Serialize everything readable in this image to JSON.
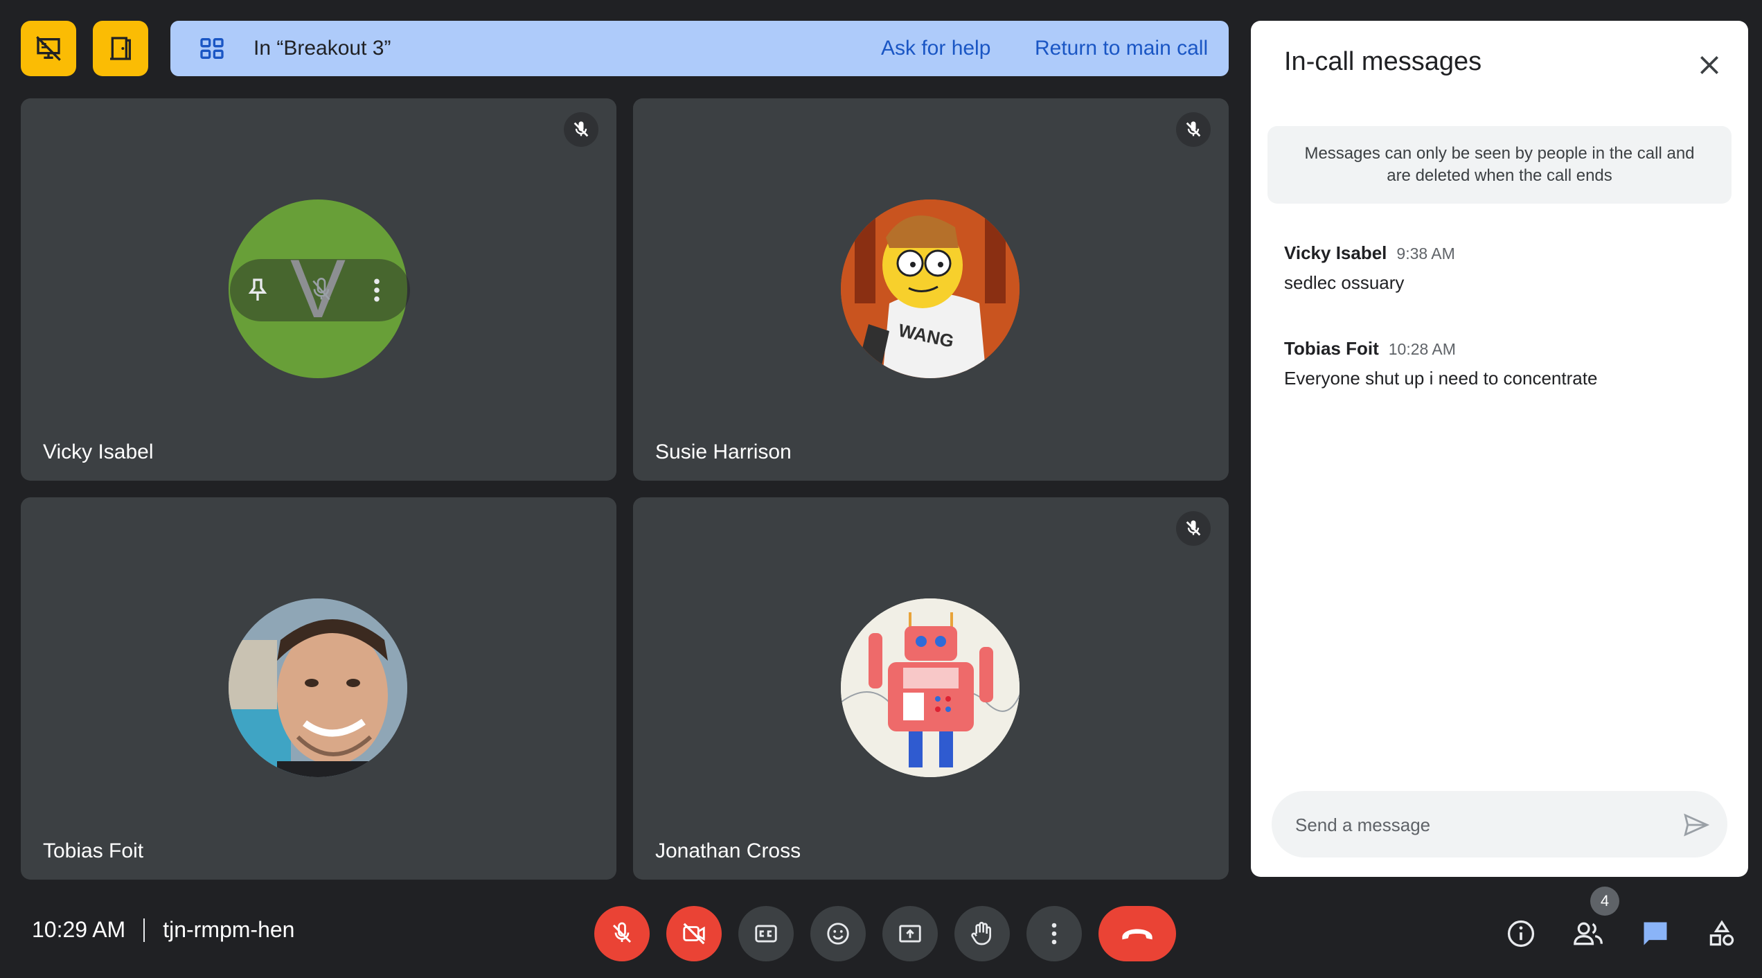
{
  "banner": {
    "title": "In “Breakout 3”",
    "ask_help": "Ask for help",
    "return_main": "Return to main call"
  },
  "tiles": [
    {
      "name": "Vicky Isabel",
      "initial": "V",
      "muted": true,
      "avatar": "green-initial"
    },
    {
      "name": "Susie Harrison",
      "muted": true,
      "avatar": "cartoon"
    },
    {
      "name": "Tobias Foit",
      "muted": false,
      "avatar": "photo"
    },
    {
      "name": "Jonathan Cross",
      "muted": true,
      "avatar": "robot"
    }
  ],
  "panel": {
    "title": "In-call messages",
    "notice": "Messages can only be seen by people in the call and are deleted when the call ends",
    "messages": [
      {
        "sender": "Vicky Isabel",
        "time": "9:38 AM",
        "text": "sedlec ossuary"
      },
      {
        "sender": "Tobias Foit",
        "time": "10:28 AM",
        "text": "Everyone shut up i need to concentrate"
      }
    ],
    "input_placeholder": "Send a message"
  },
  "footer": {
    "time": "10:29 AM",
    "meeting_code": "tjn-rmpm-hen",
    "participants_count": "4"
  },
  "colors": {
    "background": "#202124",
    "tile": "#3c4043",
    "accent_yellow": "#fbbc04",
    "banner": "#aecbfa",
    "danger": "#ea4335",
    "chat_active": "#8ab4f8"
  }
}
